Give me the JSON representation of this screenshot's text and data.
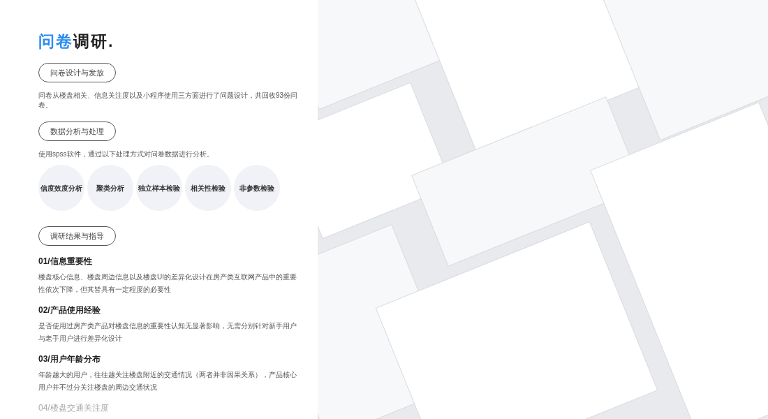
{
  "title": {
    "accent": "问卷",
    "rest": "调研."
  },
  "sections": [
    {
      "button": "问卷设计与发放",
      "text": "问卷从楼盘相关、信息关注度以及小程序使用三方面进行了问题设计，共回收93份问卷。"
    },
    {
      "button": "数据分析与处理",
      "text": "使用spss软件，通过以下处理方式对问卷数据进行分析。",
      "methods": [
        "信度效度分析",
        "聚类分析",
        "独立样本检验",
        "相关性检验",
        "非参数检验"
      ]
    },
    {
      "button": "调研结果与指导"
    }
  ],
  "findings": [
    {
      "heading": "01/信息重要性",
      "text": "楼盘核心信息、楼盘周边信息以及楼盘UI的差异化设计在房产类互联网产品中的重要性依次下降，但其皆具有一定程度的必要性",
      "dimmed": false
    },
    {
      "heading": "02/产品使用经验",
      "text": "是否使用过房产类产品对楼盘信息的重要性认知无显著影响，无需分别针对新手用户与老手用户进行差异化设计",
      "dimmed": false
    },
    {
      "heading": "03/用户年龄分布",
      "text": "年龄越大的用户，往往越关注楼盘附近的交通情况（两者并非因果关系），产品核心用户并不过分关注楼盘的周边交通状况",
      "dimmed": false
    },
    {
      "heading": "04/楼盘交通关注度",
      "dimmed": true
    }
  ]
}
